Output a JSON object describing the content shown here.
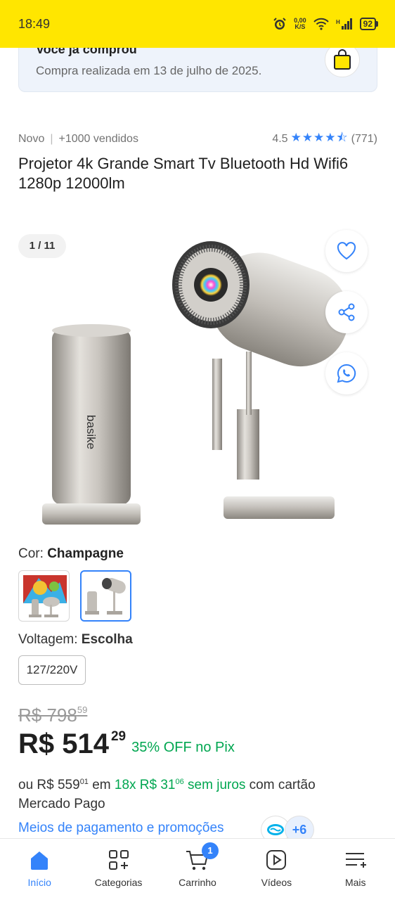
{
  "status_bar": {
    "time": "18:49",
    "speed_value": "0,00",
    "speed_unit": "K/S",
    "battery": "92"
  },
  "purchase_notice": {
    "title": "Você já comprou",
    "subtitle": "Compra realizada em 13 de julho de 2025."
  },
  "product": {
    "condition": "Novo",
    "sold": "+1000 vendidos",
    "rating": "4.5",
    "stars": "★★★★⯪",
    "reviews": "(771)",
    "title": "Projetor 4k Grande Smart Tv Bluetooth Hd Wifi6 1280p 12000lm",
    "brand_text": "basike"
  },
  "gallery": {
    "counter": "1 / 11"
  },
  "color": {
    "label": "Cor:",
    "value": "Champagne"
  },
  "voltage": {
    "label": "Voltagem:",
    "value": "Escolha",
    "option": "127/220V"
  },
  "price": {
    "old_int": "R$ 798",
    "old_cents": "59",
    "current_int": "R$ 514",
    "current_cents": "29",
    "discount": "35% OFF no Pix"
  },
  "installments": {
    "prefix": "ou R$ 559",
    "prefix_cents": "01",
    "mid": " em ",
    "plan": "18x R$ 31",
    "plan_cents": "06",
    "interest": " sem juros",
    "suffix": " com cartão Mercado Pago"
  },
  "payments": {
    "link": "Meios de pagamento e promoções",
    "more": "+6"
  },
  "bottom_nav": {
    "items": [
      {
        "label": "Início",
        "icon": "home-icon"
      },
      {
        "label": "Categorias",
        "icon": "categories-icon"
      },
      {
        "label": "Carrinho",
        "icon": "cart-icon",
        "badge": "1"
      },
      {
        "label": "Vídeos",
        "icon": "video-icon"
      },
      {
        "label": "Mais",
        "icon": "menu-icon"
      }
    ]
  },
  "colors": {
    "accent": "#3483fa",
    "brand_yellow": "#ffe600",
    "discount_green": "#00a650"
  }
}
